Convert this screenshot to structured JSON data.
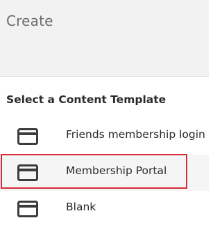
{
  "header": {
    "title": "Create"
  },
  "section": {
    "title": "Select a Content Template"
  },
  "templates": [
    {
      "label": "Friends membership login",
      "icon": "card-icon"
    },
    {
      "label": "Membership Portal",
      "icon": "card-icon",
      "highlighted": true
    },
    {
      "label": "Blank",
      "icon": "card-icon"
    }
  ],
  "colors": {
    "header_bg": "#f2f2f2",
    "highlight_border": "#d62b3a",
    "text": "#2b2b2b"
  }
}
